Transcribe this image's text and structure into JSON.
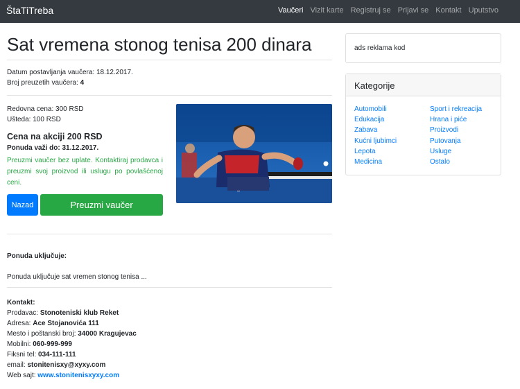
{
  "navbar": {
    "brand": "ŠtaTiTreba",
    "items": [
      "Vaučeri",
      "Vizit karte",
      "Registruj se",
      "Prijavi se",
      "Kontakt",
      "Uputstvo"
    ],
    "active_index": 0
  },
  "voucher": {
    "title": "Sat vremena stonog tenisa 200 dinara",
    "posted_label": "Datum postavljanja vaučera:",
    "posted_date": "18.12.2017.",
    "taken_label": "Broj preuzetih vaučera:",
    "taken_count": "4",
    "regular_price": "Redovna cena: 300 RSD",
    "savings": "Ušteda: 100 RSD",
    "promo_price": "Cena na akciji 200 RSD",
    "valid_until": "Ponuda važi do: 31.12.2017.",
    "info_text": "Preuzmi vaučer bez uplate. Kontaktiraj prodavca i preuzmi svoj proizvod ili uslugu po povlašćenoj ceni.",
    "back_button": "Nazad",
    "take_button": "Preuzmi vaučer",
    "includes_heading": "Ponuda uključuje:",
    "includes_text": "Ponuda uključuje sat vremen stonog tenisa ..."
  },
  "contact": {
    "heading": "Kontakt:",
    "seller_label": "Prodavac:",
    "seller": "Stonoteniski klub Reket",
    "address_label": "Adresa:",
    "address": "Ace Stojanovića 111",
    "city_label": "Mesto i poštanski broj:",
    "city": "34000 Kragujevac",
    "mobile_label": "Mobilni:",
    "mobile": "060-999-999",
    "phone_label": "Fiksni tel:",
    "phone": "034-111-111",
    "email_label": "email:",
    "email": "stonitenisxy@xyxy.com",
    "web_label": "Web sajt:",
    "web": "www.stonitenisxyxy.com"
  },
  "sidebar": {
    "ad_text": "ads reklama kod",
    "categories_title": "Kategorije",
    "categories_left": [
      "Automobili",
      "Edukacija",
      "Zabava",
      "Kućni ljubimci",
      "Lepota",
      "Medicina"
    ],
    "categories_right": [
      "Sport i rekreacija",
      "Hrana i piće",
      "Proizvodi",
      "Putovanja",
      "Usluge",
      "Ostalo"
    ]
  },
  "colors": {
    "navbar": "#343a40",
    "primary": "#007bff",
    "success": "#28a745"
  }
}
